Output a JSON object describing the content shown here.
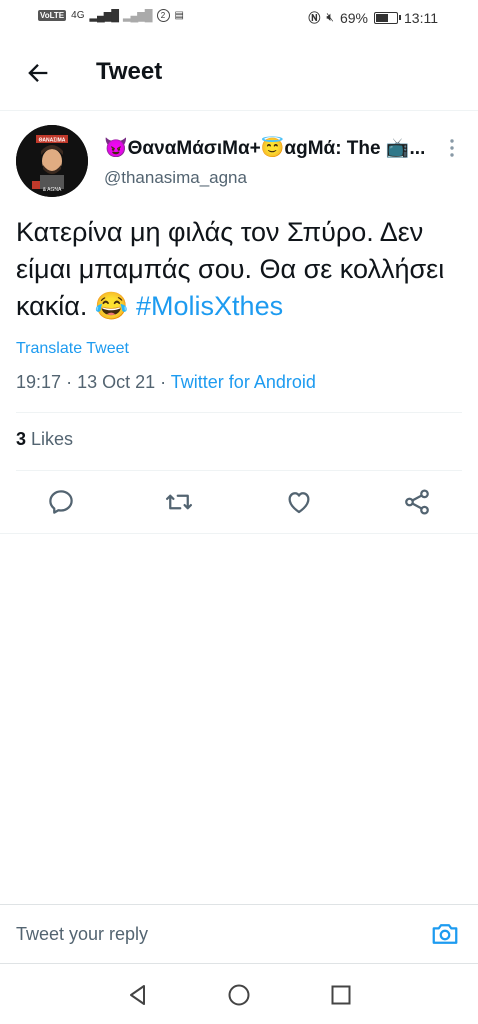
{
  "status_bar": {
    "volte": "VoLTE",
    "network": "4G",
    "sim2": "2",
    "battery_percent": "69%",
    "battery_level": 0.69,
    "time": "13:11"
  },
  "header": {
    "title": "Tweet"
  },
  "tweet": {
    "display_name": "😈ΘαναMάσιMα+😇αgMά: The 📺...",
    "username": "@thanasima_agna",
    "text": "Κατερίνα μη φιλάς τον Σπύρο. Δεν είμαι μπαμπάς σου. Θα σε κολλήσει κακία. 😂",
    "hashtag": "#MolisXthes",
    "translate_label": "Translate Tweet",
    "time": "19:17",
    "date": "13 Oct 21",
    "source": "Twitter for Android",
    "likes_count": "3",
    "likes_label": "Likes"
  },
  "avatar": {
    "label_top": "ΘΑΝΑΣΙΜΑ",
    "label_bottom": "& AGNA"
  },
  "reply": {
    "placeholder": "Tweet your reply"
  },
  "colors": {
    "accent": "#1d9bf0",
    "secondary_text": "#536471"
  }
}
